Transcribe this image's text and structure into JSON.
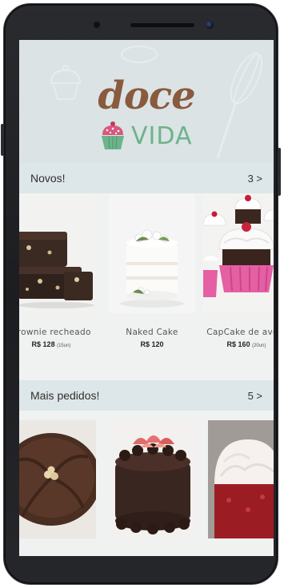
{
  "brand": {
    "word1": "doce",
    "word2": "VIDA"
  },
  "sections": {
    "novos": {
      "title": "Novos!",
      "more": "3 >",
      "products": [
        {
          "name": "Brownie recheado",
          "price": "R$ 128",
          "qty": "(15un)"
        },
        {
          "name": "Naked Cake",
          "price": "R$ 120",
          "qty": ""
        },
        {
          "name": "CapCake de avelã",
          "price": "R$ 160",
          "qty": "(20un)"
        }
      ]
    },
    "mais_pedidos": {
      "title": "Mais pedidos!",
      "more": "5 >"
    }
  },
  "colors": {
    "brand_brown": "#8a5a3e",
    "brand_green": "#6db38b",
    "header_bg": "#dbe3e5",
    "section_bar": "#dde6e8",
    "cupcake_pink": "#d9577e"
  }
}
